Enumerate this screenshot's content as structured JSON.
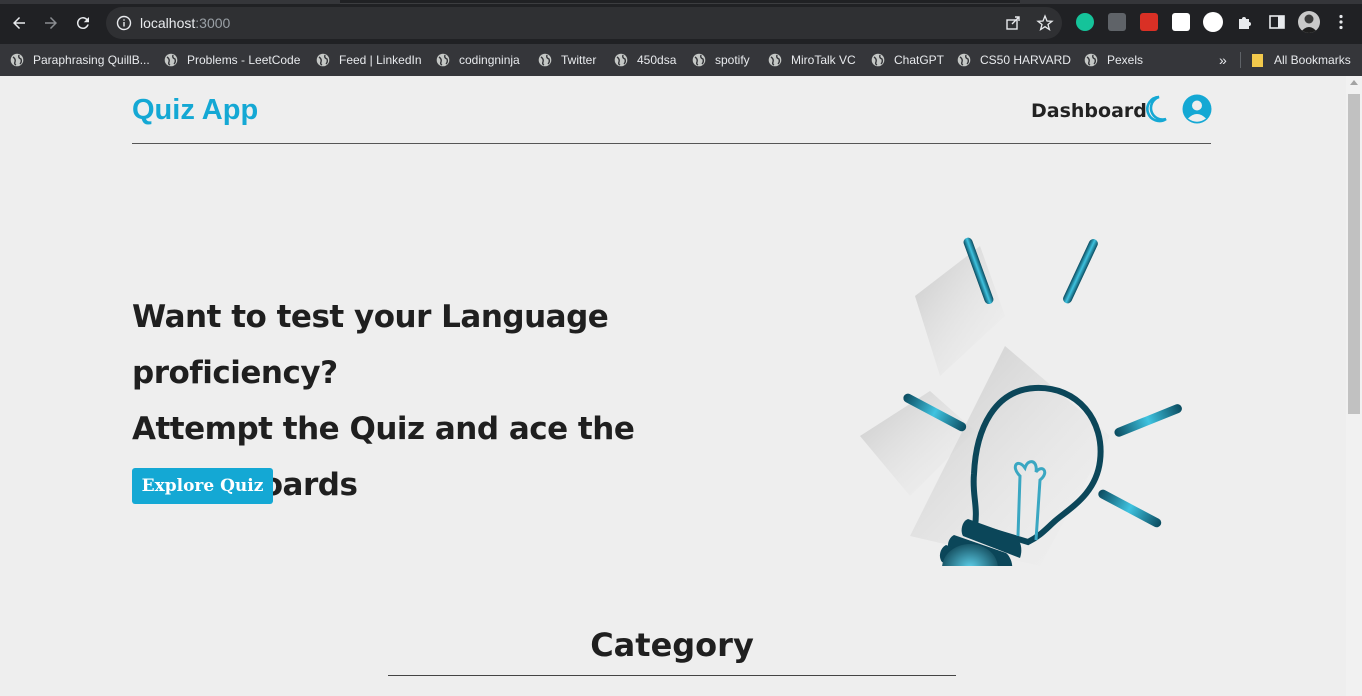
{
  "browser": {
    "url_host": "localhost",
    "url_port": ":3000",
    "bookmarks": [
      "Paraphrasing QuillB...",
      "Problems - LeetCode",
      "Feed | LinkedIn",
      "codingninja",
      "Twitter",
      "450dsa",
      "spotify",
      "MiroTalk VC",
      "ChatGPT",
      "CS50 HARVARD",
      "Pexels"
    ],
    "more_bookmarks": "»",
    "all_bookmarks": "All Bookmarks"
  },
  "navbar": {
    "brand": "Quiz App",
    "dashboard": "Dashboard"
  },
  "hero": {
    "line1": "Want to test your Language proficiency?",
    "line2": "Attempt the Quiz and ace the",
    "line3": "leaderboards",
    "button": "Explore Quiz"
  },
  "category": {
    "title": "Category"
  },
  "colors": {
    "accent": "#14a8d4",
    "page_bg": "#eeeeee",
    "text": "#1f1f1f"
  }
}
